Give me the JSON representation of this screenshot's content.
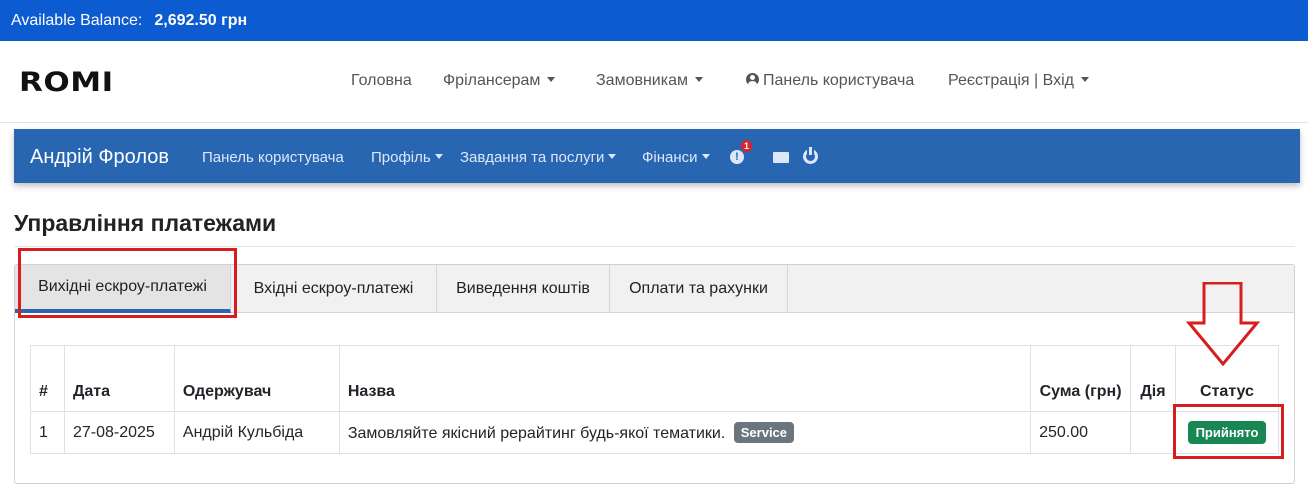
{
  "balance": {
    "label": "Available Balance:",
    "value": "2,692.50 грн"
  },
  "header": {
    "logo": "ROMI",
    "nav": [
      "Головна",
      "Фрілансерам",
      "Замовникам",
      "Панель користувача",
      "Реєстрація | Вхід"
    ]
  },
  "dashboard": {
    "user_name": "Андрій Фролов",
    "links": [
      "Панель користувача",
      "Профіль",
      "Завдання та послуги",
      "Фінанси"
    ],
    "notification_count": "1",
    "alert_glyph": "!"
  },
  "page": {
    "title": "Управління платежами"
  },
  "tabs": [
    "Вихідні ескроу-платежі",
    "Вхідні ескроу-платежі",
    "Виведення коштів",
    "Оплати та рахунки"
  ],
  "table": {
    "headers": [
      "#",
      "Дата",
      "Одержувач",
      "Назва",
      "Сума (грн)",
      "Дія",
      "Статус"
    ],
    "rows": [
      {
        "num": "1",
        "date": "27-08-2025",
        "recipient": "Андрій Кульбіда",
        "title": "Замовляйте якісний рерайтинг будь-якої тематики.",
        "tag": "Service",
        "amount": "250.00",
        "action": "",
        "status": "Прийнято"
      }
    ]
  },
  "colors": {
    "balance_bar": "#0d5bd1",
    "dashboard_bar": "#2966b2",
    "status_accepted": "#198754",
    "annotation": "#d71e1e"
  }
}
